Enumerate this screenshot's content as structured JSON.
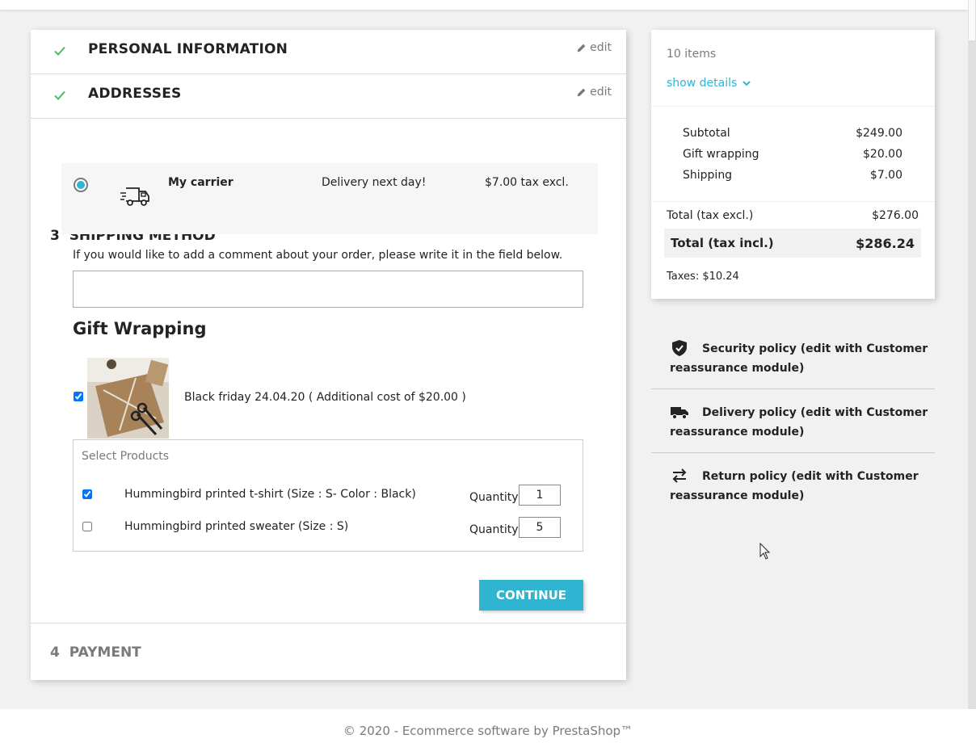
{
  "checkout": {
    "steps": [
      {
        "title": "PERSONAL INFORMATION",
        "edit": "edit"
      },
      {
        "title": "ADDRESSES",
        "edit": "edit"
      }
    ],
    "shipping": {
      "number": "3",
      "title": "SHIPPING METHOD",
      "carrier_name": "My carrier",
      "carrier_delay": "Delivery next day!",
      "carrier_price": "$7.00 tax excl.",
      "comment_label": "If you would like to add a comment about your order, please write it in the field below.",
      "comment_value": ""
    },
    "gift": {
      "title": "Gift Wrapping",
      "option_label": "Black friday 24.04.20 ( Additional cost of $20.00 )",
      "option_checked": true,
      "select_title": "Select Products",
      "quantity_label": "Quantity",
      "products": [
        {
          "name": "Hummingbird printed t-shirt (Size : S- Color : Black)",
          "checked": true,
          "quantity": "1"
        },
        {
          "name": "Hummingbird printed sweater (Size : S)",
          "checked": false,
          "quantity": "5"
        }
      ]
    },
    "continue_label": "CONTINUE",
    "payment": {
      "number": "4",
      "title": "PAYMENT"
    }
  },
  "summary": {
    "items": "10 items",
    "show_details": "show details",
    "lines": [
      {
        "label": "Subtotal",
        "value": "$249.00"
      },
      {
        "label": "Gift wrapping",
        "value": "$20.00"
      },
      {
        "label": "Shipping",
        "value": "$7.00"
      }
    ],
    "total_excl_label": "Total (tax excl.)",
    "total_excl_value": "$276.00",
    "total_incl_label": "Total (tax incl.)",
    "total_incl_value": "$286.24",
    "taxes": "Taxes: $10.24"
  },
  "reassurance": [
    {
      "icon": "shield-icon",
      "text": "Security policy (edit with Customer reassurance module)"
    },
    {
      "icon": "truck-icon",
      "text": "Delivery policy (edit with Customer reassurance module)"
    },
    {
      "icon": "swap-arrows-icon",
      "text": "Return policy (edit with Customer reassurance module)"
    }
  ],
  "footer": "© 2020 - Ecommerce software by PrestaShop™",
  "colors": {
    "accent": "#2fb5d2",
    "check": "#4cbb6c",
    "text": "#232323",
    "muted": "#7a7a7a"
  }
}
